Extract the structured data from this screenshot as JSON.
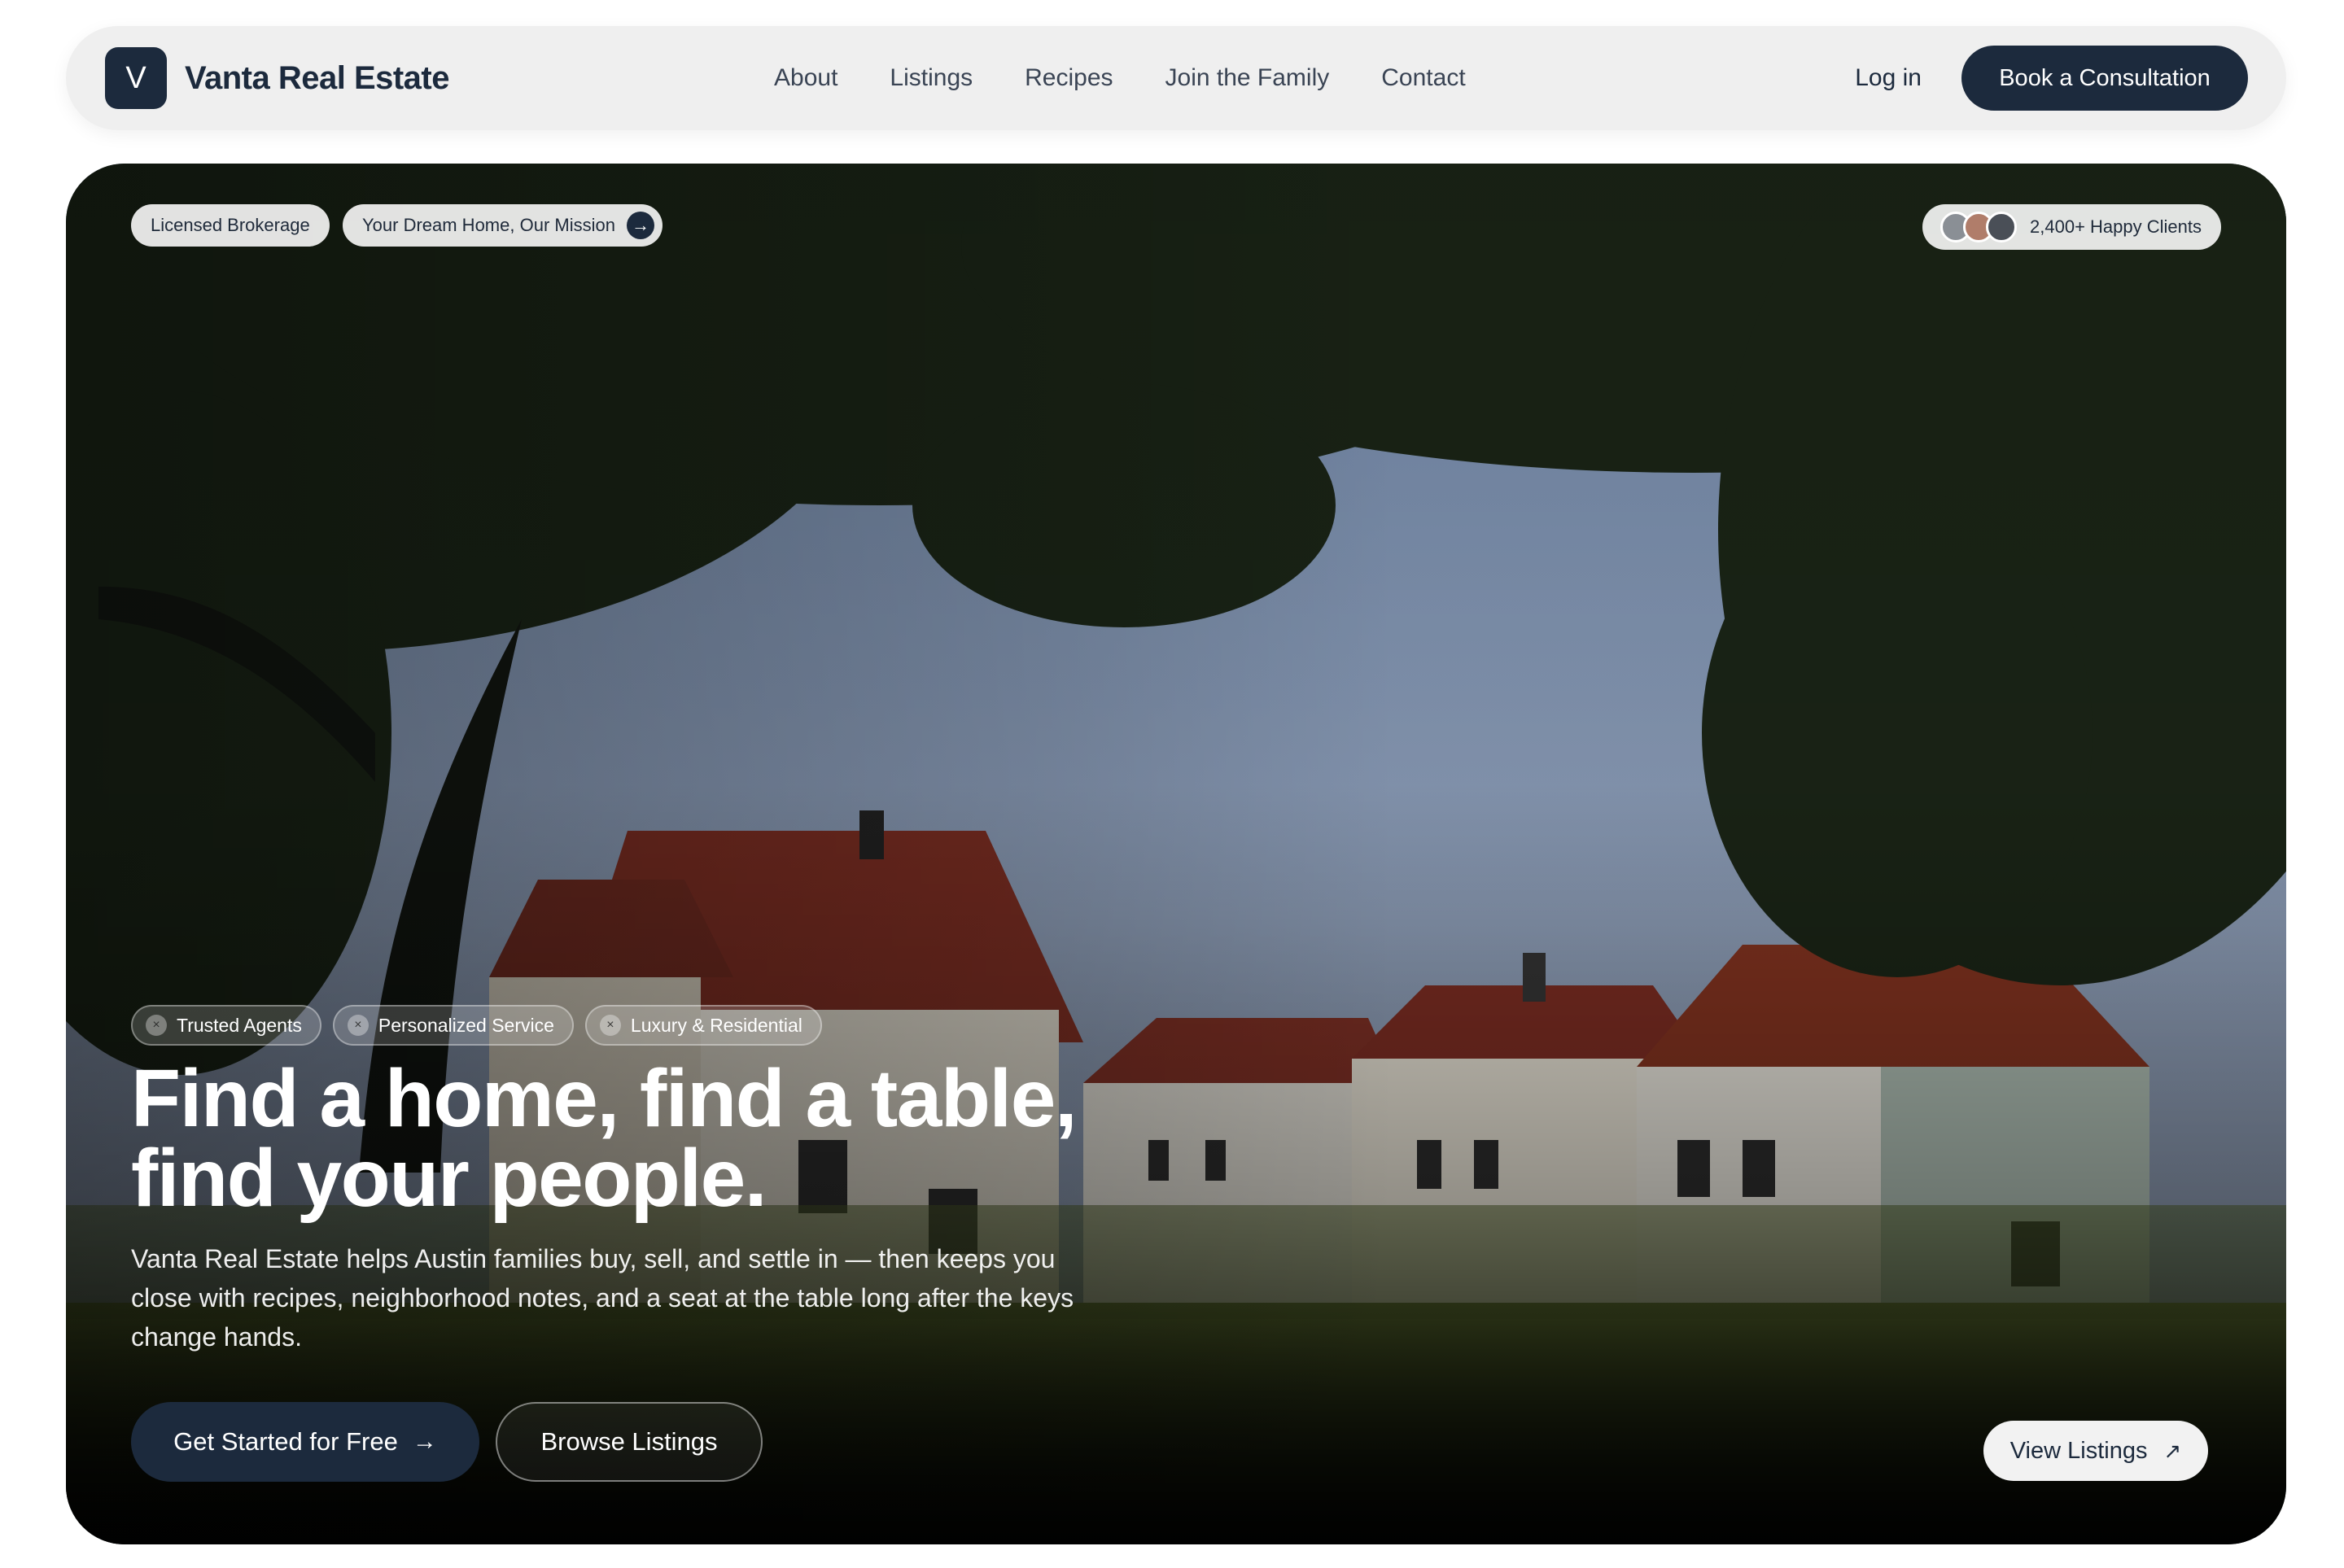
{
  "brand": {
    "mark": "V",
    "name": "Vanta Real Estate"
  },
  "nav": {
    "links": [
      "About",
      "Listings",
      "Recipes",
      "Join the Family",
      "Contact"
    ],
    "login": "Log in",
    "cta": "Book a Consultation"
  },
  "hero": {
    "badge_left": "Licensed Brokerage",
    "badge_mission": "Your Dream Home, Our Mission",
    "clients": "2,400+ Happy Clients",
    "tags": [
      "Trusted Agents",
      "Personalized Service",
      "Luxury & Residential"
    ],
    "headline_line1": "Find a home, find a table,",
    "headline_line2": "find your people.",
    "subtext": "Vanta Real Estate helps Austin families buy, sell, and settle in — then keeps you close with recipes, neighborhood notes, and a seat at the table long after the keys change hands.",
    "primary_button": "Get Started for Free",
    "secondary_button": "Browse Listings",
    "view_button": "View Listings"
  },
  "icons": {
    "arrow_right": "→",
    "arrow_up_right": "↗",
    "tag_close": "×"
  },
  "colors": {
    "brand_navy": "#1c2a3d",
    "nav_bg": "#efefef"
  }
}
